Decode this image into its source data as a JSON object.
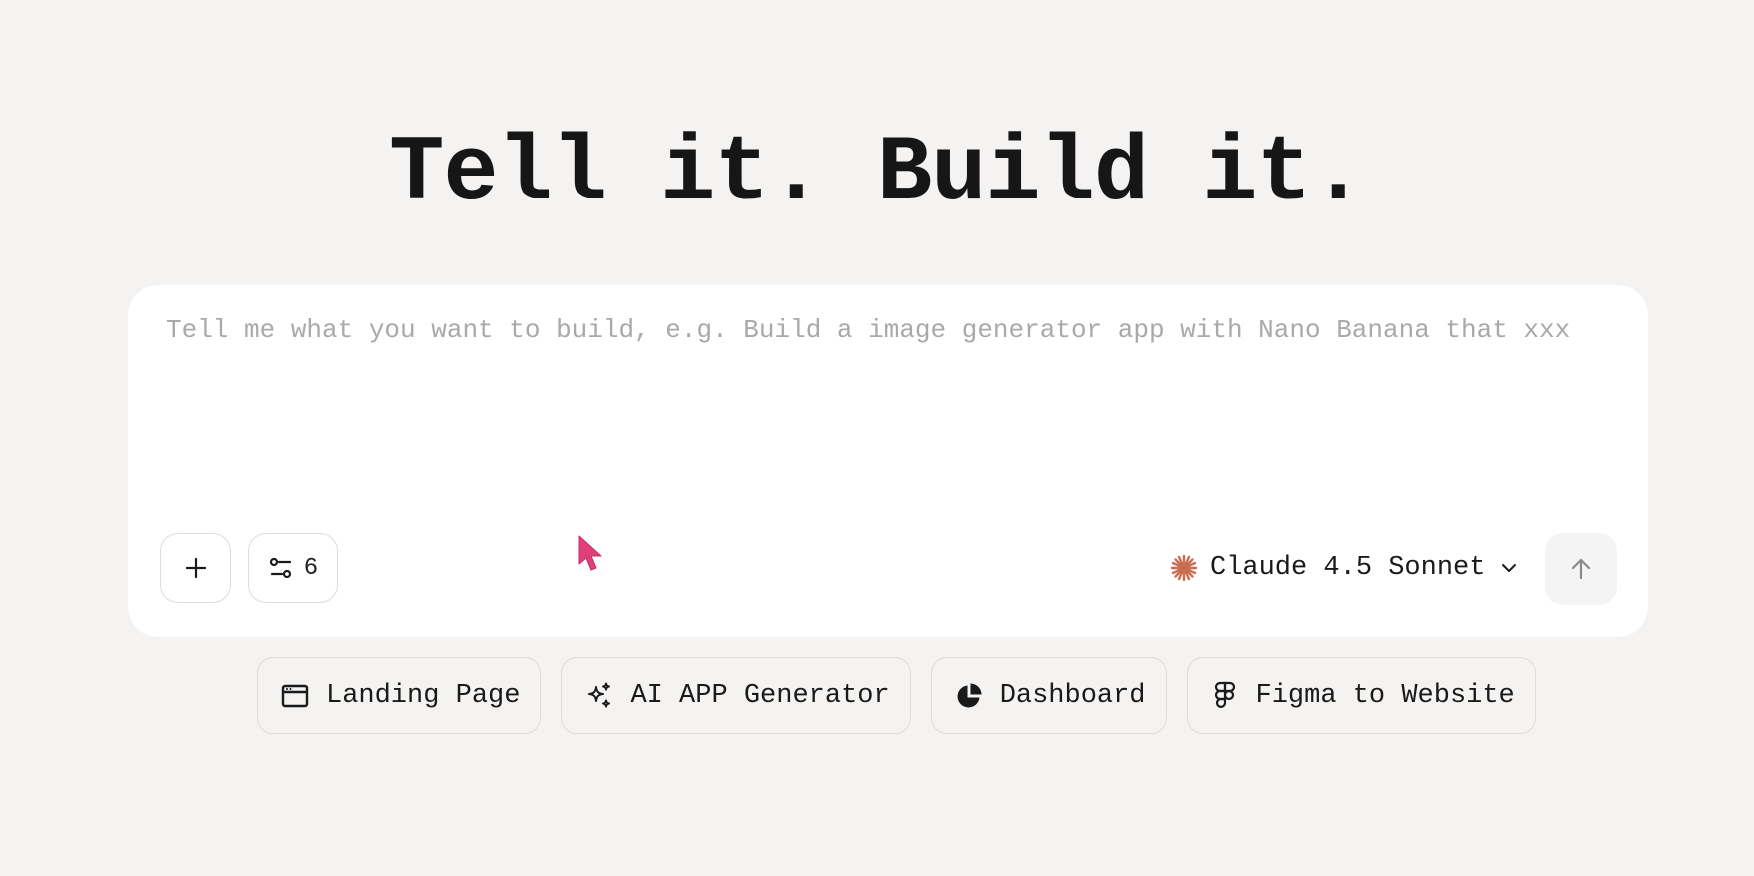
{
  "headline": "Tell it. Build it.",
  "composer": {
    "placeholder": "Tell me what you want to build, e.g. Build a image generator app with Nano Banana that xxx",
    "value": "",
    "add_button_icon": "plus-icon",
    "settings_button": {
      "icon": "sliders-icon",
      "count": "6"
    },
    "model": {
      "icon": "claude-starburst-icon",
      "label": "Claude 4.5 Sonnet",
      "dropdown_icon": "chevron-down-icon",
      "icon_color": "#c96f4f"
    },
    "send_button_icon": "arrow-up-icon"
  },
  "suggestions": [
    {
      "label": "Landing Page",
      "icon": "browser-window-icon"
    },
    {
      "label": "AI APP Generator",
      "icon": "sparkles-icon"
    },
    {
      "label": "Dashboard",
      "icon": "pie-chart-icon"
    },
    {
      "label": "Figma to Website",
      "icon": "figma-icon"
    }
  ],
  "colors": {
    "background": "#f4f3f1",
    "card": "#ffffff",
    "cursor": "#e0407a"
  }
}
